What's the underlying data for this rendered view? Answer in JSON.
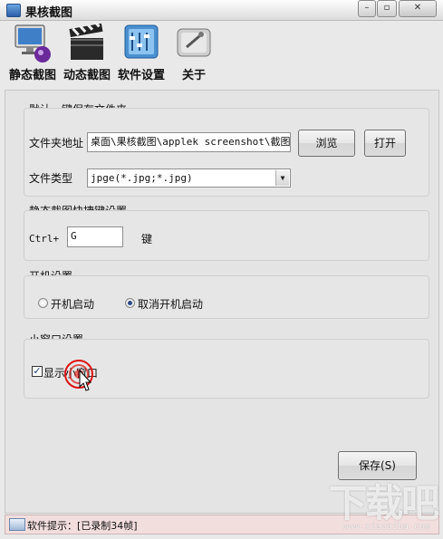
{
  "window": {
    "title": "果核截图"
  },
  "toolbar": {
    "items": [
      {
        "label": "静态截图",
        "icon": "monitor-icon"
      },
      {
        "label": "动态截图",
        "icon": "clapperboard-icon"
      },
      {
        "label": "软件设置",
        "icon": "settings-panel-icon"
      },
      {
        "label": "关于",
        "icon": "info-card-icon"
      }
    ]
  },
  "save_folder": {
    "group_title": "默认一键保存文件夹",
    "path_label": "文件夹地址",
    "path_value": "桌面\\果核截图\\applek  screenshot\\截图",
    "browse_label": "浏览",
    "open_label": "打开",
    "type_label": "文件类型",
    "type_value": "jpge(*.jpg;*.jpg)"
  },
  "hotkey": {
    "group_title": "静态截图快捷键设置",
    "modifier_label": "Ctrl+",
    "key_value": "G",
    "key_suffix": "键"
  },
  "startup": {
    "group_title": "开机设置",
    "options": [
      {
        "label": "开机启动",
        "selected": false
      },
      {
        "label": "取消开机启动",
        "selected": true
      }
    ]
  },
  "mini_window": {
    "group_title": "小窗口设置",
    "checkbox_label": "显示小窗口",
    "checked": true
  },
  "actions": {
    "save_label": "保存(S)"
  },
  "status": {
    "text": "软件提示：[已录制34帧]"
  },
  "watermark": {
    "text": "下载吧",
    "sub": "www.xiazaiba.com"
  },
  "colors": {
    "accent": "#2b4a85",
    "status_bg": "#f3dede"
  }
}
